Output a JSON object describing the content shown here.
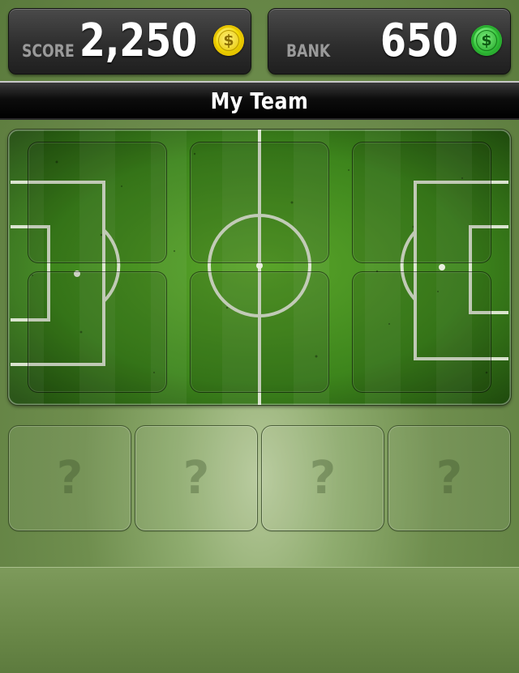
{
  "score": {
    "label": "SCORE",
    "value": "2,250",
    "coin_icon": "gold-coin-icon",
    "coin_symbol": "$"
  },
  "bank": {
    "label": "BANK",
    "value": "650",
    "coin_icon": "green-coin-icon",
    "coin_symbol": "$"
  },
  "title": "My Team",
  "pitch": {
    "slots": [
      {
        "id": "slot-1"
      },
      {
        "id": "slot-2"
      },
      {
        "id": "slot-3"
      },
      {
        "id": "slot-4"
      },
      {
        "id": "slot-5"
      },
      {
        "id": "slot-6"
      }
    ]
  },
  "bench": [
    {
      "symbol": "?"
    },
    {
      "symbol": "?"
    },
    {
      "symbol": "?"
    },
    {
      "symbol": "?"
    }
  ],
  "colors": {
    "gold_coin": "#f2d900",
    "green_coin": "#34c43a",
    "pitch_green": "#3f8a1e",
    "background": "#6f8e4e"
  }
}
